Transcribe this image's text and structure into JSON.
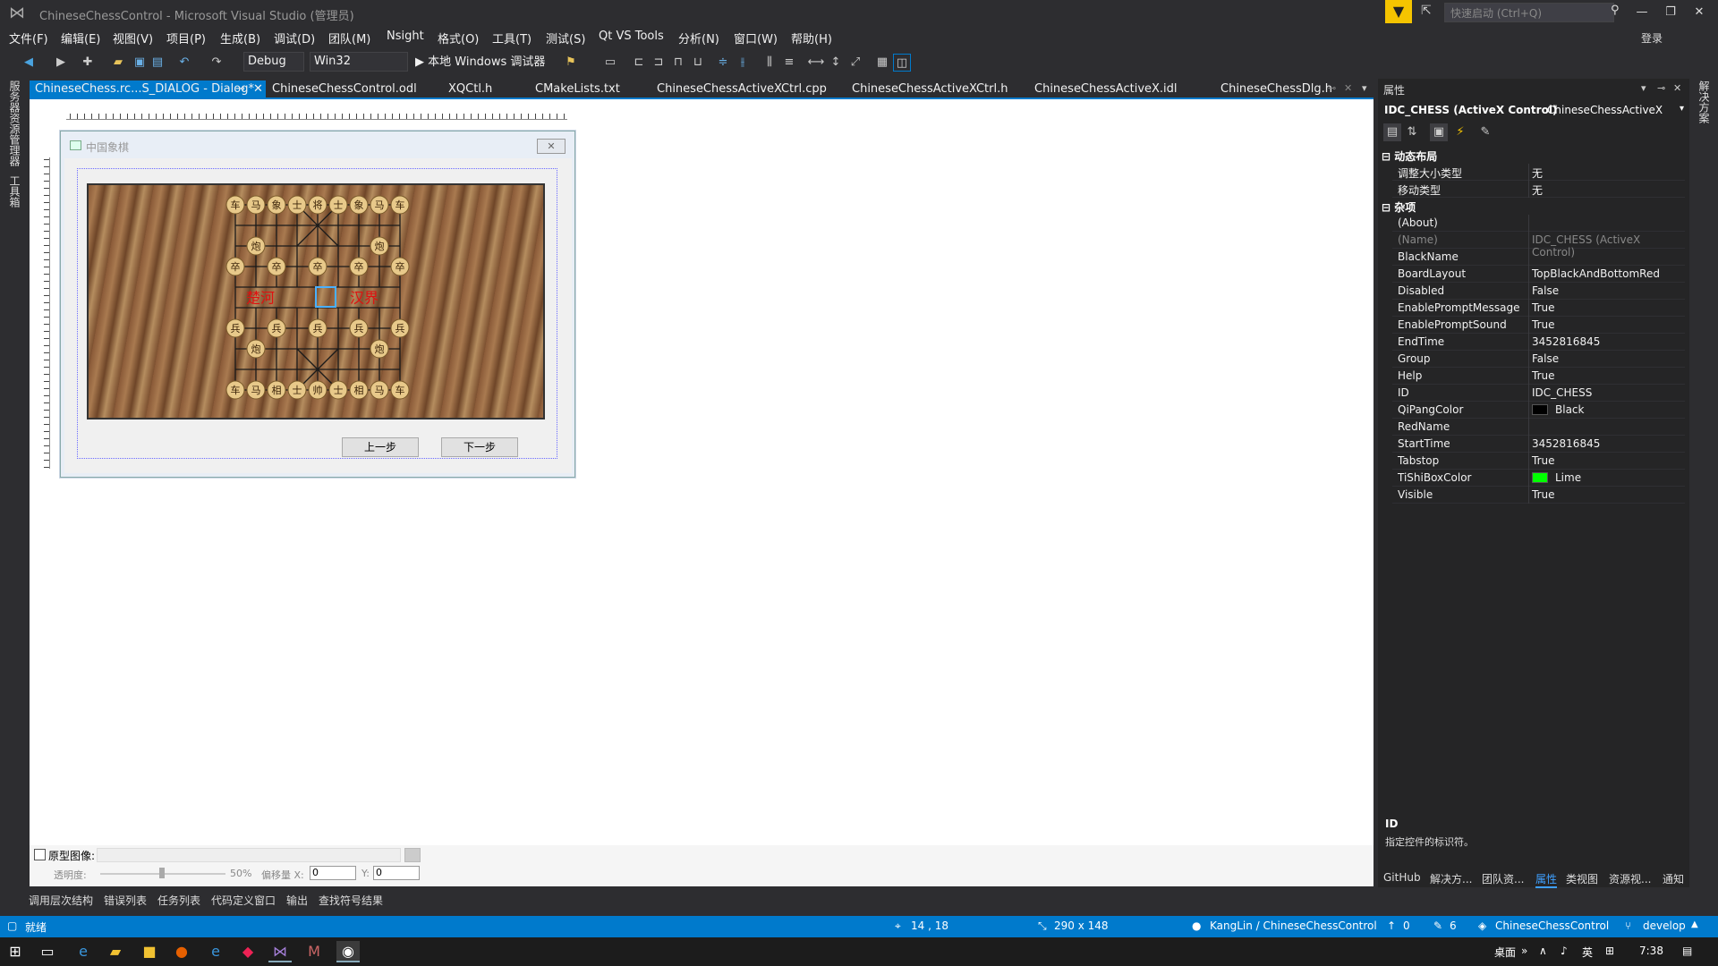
{
  "window": {
    "title": "ChineseChessControl - Microsoft Visual Studio (管理员)",
    "quick_launch_placeholder": "快速启动 (Ctrl+Q)",
    "login": "登录"
  },
  "menu": [
    "文件(F)",
    "编辑(E)",
    "视图(V)",
    "项目(P)",
    "生成(B)",
    "调试(D)",
    "团队(M)",
    "Nsight",
    "格式(O)",
    "工具(T)",
    "测试(S)",
    "Qt VS Tools",
    "分析(N)",
    "窗口(W)",
    "帮助(H)"
  ],
  "toolbar": {
    "config": "Debug",
    "platform": "Win32",
    "debugger": "▶ 本地 Windows 调试器"
  },
  "left_tabs": [
    "服务器资源管理器",
    "工具箱"
  ],
  "right_tabs": [
    "解决方案"
  ],
  "doc_tabs": [
    "ChineseChess.rc...S_DIALOG - Dialog*",
    "ChineseChessControl.odl",
    "XQCtl.h",
    "CMakeLists.txt",
    "ChineseChessActiveXCtrl.cpp",
    "ChineseChessActiveXCtrl.h",
    "ChineseChessActiveX.idl",
    "ChineseChessDlg.h"
  ],
  "dialog": {
    "title": "中国象棋",
    "close": "✕",
    "prev_button": "上一步",
    "next_button": "下一步"
  },
  "board": {
    "top_row": [
      "车",
      "马",
      "象",
      "士",
      "将",
      "士",
      "象",
      "马",
      "车"
    ],
    "top_cannon": "炮",
    "top_pawns": "卒",
    "bottom_pawns": "兵",
    "bottom_cannon": "炮",
    "bottom_row": [
      "车",
      "马",
      "相",
      "士",
      "帅",
      "士",
      "相",
      "马",
      "车"
    ],
    "river_left": "楚河",
    "river_right": "汉界"
  },
  "properties": {
    "title": "属性",
    "object_name": "IDC_CHESS (ActiveX Control)",
    "object_type": "ChineseChessActiveX",
    "categories": [
      {
        "name": "动态布局",
        "rows": [
          {
            "name": "调整大小类型",
            "value": "无"
          },
          {
            "name": "移动类型",
            "value": "无"
          }
        ]
      },
      {
        "name": "杂项",
        "rows": [
          {
            "name": "(About)",
            "value": ""
          },
          {
            "name": "(Name)",
            "value": "IDC_CHESS (ActiveX Control)"
          },
          {
            "name": "BlackName",
            "value": ""
          },
          {
            "name": "BoardLayout",
            "value": "TopBlackAndBottomRed"
          },
          {
            "name": "Disabled",
            "value": "False"
          },
          {
            "name": "EnablePromptMessage",
            "value": "True"
          },
          {
            "name": "EnablePromptSound",
            "value": "True"
          },
          {
            "name": "EndTime",
            "value": "3452816845"
          },
          {
            "name": "Group",
            "value": "False"
          },
          {
            "name": "Help",
            "value": "True"
          },
          {
            "name": "ID",
            "value": "IDC_CHESS"
          },
          {
            "name": "QiPangColor",
            "value": "Black"
          },
          {
            "name": "RedName",
            "value": ""
          },
          {
            "name": "StartTime",
            "value": "3452816845"
          },
          {
            "name": "Tabstop",
            "value": "True"
          },
          {
            "name": "TiShiBoxColor",
            "value": "Lime"
          },
          {
            "name": "Visible",
            "value": "True"
          }
        ]
      }
    ],
    "swatch_black": "#000000",
    "swatch_lime": "#00ff00",
    "desc_name": "ID",
    "desc_text": "指定控件的标识符。",
    "bottom_tabs": [
      "GitHub",
      "解决方...",
      "团队资...",
      "属性",
      "类视图",
      "资源视...",
      "通知"
    ]
  },
  "prototype": {
    "label": "原型图像:",
    "opacity_label": "透明度:",
    "opacity_value": "50%",
    "offset_label": "偏移量 X:",
    "offset_x": "0",
    "y_label": "Y:",
    "offset_y": "0"
  },
  "output_tabs": [
    "调用层次结构",
    "错误列表",
    "任务列表",
    "代码定义窗口",
    "输出",
    "查找符号结果"
  ],
  "status": {
    "ready": "就绪",
    "position": "14 , 18",
    "size": "290 x 148",
    "repo": "KangLin / ChineseChessControl",
    "up": "0",
    "pencil": "6",
    "project": "ChineseChessControl",
    "branch": "develop"
  },
  "taskbar": {
    "desktop": "桌面",
    "ime": "英",
    "time": "7:38"
  }
}
